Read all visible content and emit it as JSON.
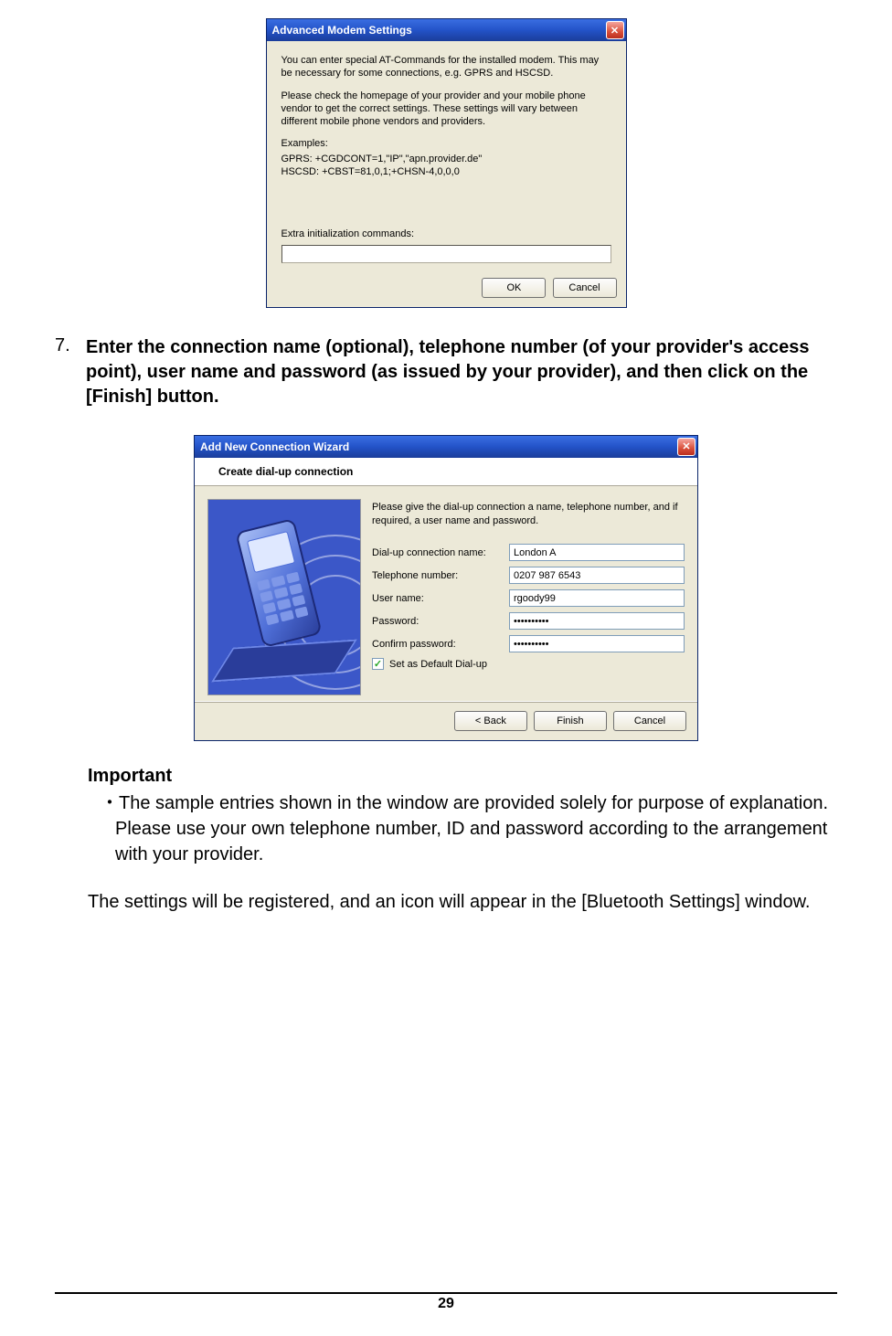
{
  "dlg1": {
    "title": "Advanced Modem Settings",
    "p1": "You can enter special AT-Commands for the installed modem. This may be necessary for some connections, e.g. GPRS and HSCSD.",
    "p2": "Please check the homepage of your provider and your mobile phone vendor to get the correct settings. These settings will vary between different mobile phone vendors and providers.",
    "examples_label": "Examples:",
    "ex1": "GPRS: +CGDCONT=1,\"IP\",\"apn.provider.de\"",
    "ex2": "HSCSD: +CBST=81,0,1;+CHSN-4,0,0,0",
    "extra_label": "Extra initialization commands:",
    "ok": "OK",
    "cancel": "Cancel"
  },
  "step7": {
    "num": "7.",
    "text": "Enter the connection name (optional), telephone number (of your provider's access point), user name and password (as issued by your provider), and then click on the [Finish] button."
  },
  "dlg2": {
    "title": "Add New Connection Wizard",
    "header": "Create dial-up connection",
    "intro": "Please give the dial-up connection a name, telephone number, and if required, a user name and password.",
    "labels": {
      "name": "Dial-up connection name:",
      "phone": "Telephone number:",
      "user": "User name:",
      "pass": "Password:",
      "confirm": "Confirm password:"
    },
    "values": {
      "name": "London A",
      "phone": "0207 987 6543",
      "user": "rgoody99",
      "pass": "••••••••••",
      "confirm": "••••••••••"
    },
    "checkbox": "Set as Default Dial-up",
    "back": "< Back",
    "finish": "Finish",
    "cancel": "Cancel"
  },
  "important": {
    "title": "Important",
    "bullet": "・The sample entries shown in the window are provided solely for purpose of explanation. Please use your own telephone number, ID and password according to the arrangement with your provider."
  },
  "outro": "The settings will be registered, and an icon will appear in the [Bluetooth Settings] window.",
  "page_number": "29"
}
